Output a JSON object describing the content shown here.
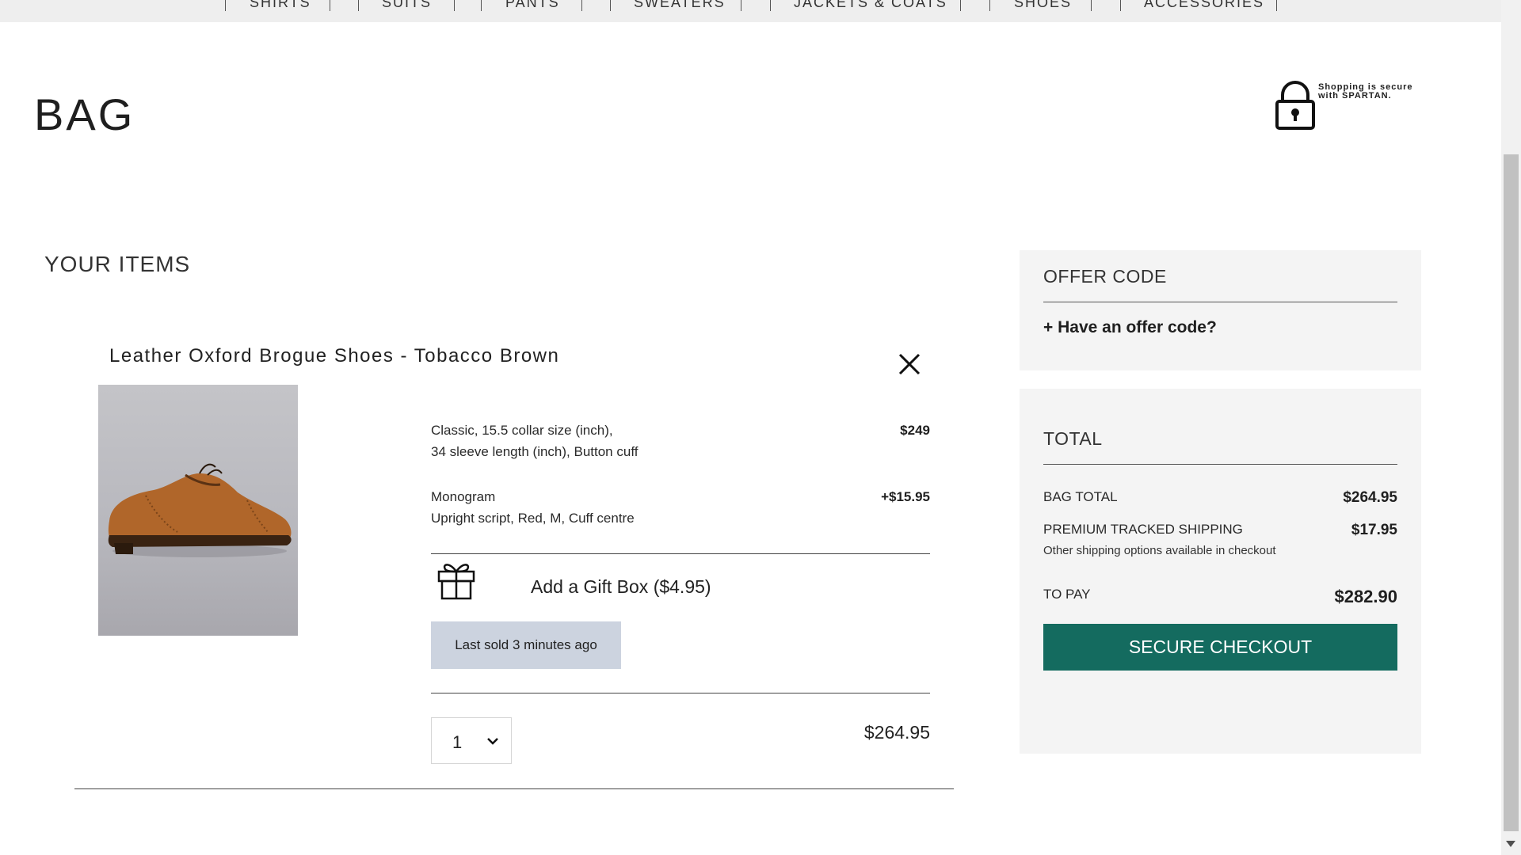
{
  "nav": {
    "items": [
      {
        "label": "SHIRTS"
      },
      {
        "label": "SUITS"
      },
      {
        "label": "PANTS"
      },
      {
        "label": "SWEATERS"
      },
      {
        "label": "JACKETS & COATS"
      },
      {
        "label": "SHOES"
      },
      {
        "label": "ACCESSORIES"
      }
    ]
  },
  "header": {
    "title": "BAG",
    "secure_text": "Shopping is secure with SPARTAN."
  },
  "items_section": {
    "heading": "YOUR ITEMS",
    "product": {
      "name": "Leather Oxford Brogue Shoes - Tobacco Brown",
      "spec_line1": "Classic, 15.5 collar size (inch),",
      "spec_line2": "34 sleeve length (inch), Button cuff",
      "spec_price": "$249",
      "monogram_title": "Monogram",
      "monogram_detail": "Upright script, Red, M, Cuff centre",
      "monogram_price": "+$15.95",
      "gift_label": "Add a Gift Box ($4.95)",
      "sold_badge": "Last sold 3 minutes ago",
      "quantity": "1",
      "line_total": "$264.95"
    }
  },
  "offer": {
    "heading": "OFFER CODE",
    "link": "+ Have an offer code?"
  },
  "summary": {
    "heading": "TOTAL",
    "bag_total_label": "BAG TOTAL",
    "bag_total_value": "$264.95",
    "shipping_label": "PREMIUM TRACKED SHIPPING",
    "shipping_value": "$17.95",
    "shipping_note": "Other shipping options available in checkout",
    "to_pay_label": "TO PAY",
    "to_pay_value": "$282.90",
    "checkout_label": "SECURE CHECKOUT"
  },
  "colors": {
    "checkout_button": "#146b5f",
    "sold_badge": "#ccd3df",
    "panel_bg": "#f4f4f4"
  },
  "icons": [
    "lock-icon",
    "close-icon",
    "gift-box-icon",
    "chevron-down-icon"
  ]
}
